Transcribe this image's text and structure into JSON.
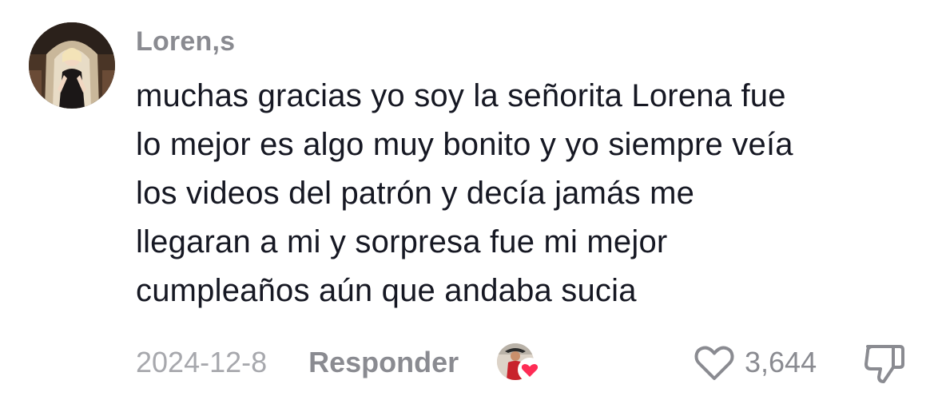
{
  "comment": {
    "username": "Loren,s",
    "text": "muchas gracias yo soy la señorita Lorena fue\nlo mejor es algo muy bonito y yo siempre veía\nlos videos del patrón y decía jamás me\nllegaran a mi y sorpresa fue mi mejor\ncumpleaños aún que andaba sucia",
    "date": "2024-12-8",
    "reply_label": "Responder",
    "likes": "3,644",
    "icons": {
      "like": "heart-outline-icon",
      "dislike": "thumbs-down-icon",
      "creator_liked": "heart-filled-icon"
    },
    "colors": {
      "text": "#161823",
      "secondary": "#8a8b91",
      "date": "#a7a8ad",
      "heart": "#fe2c55"
    }
  }
}
